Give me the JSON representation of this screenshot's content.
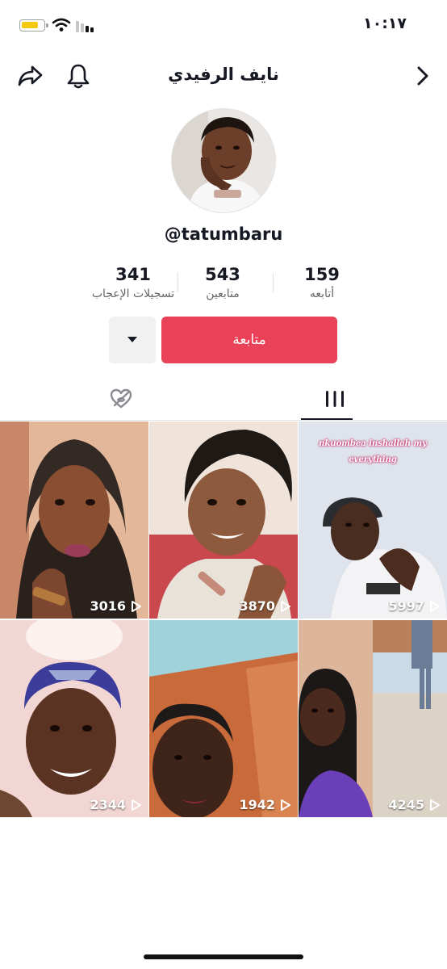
{
  "status_bar": {
    "time": "١٠:١٧"
  },
  "header": {
    "name": "نايف الرفيدي"
  },
  "profile": {
    "username": "@tatumbaru"
  },
  "stats": {
    "following": {
      "value": "159",
      "label": "أتابعه"
    },
    "followers": {
      "value": "543",
      "label": "متابعين"
    },
    "likes": {
      "value": "341",
      "label": "تسجيلات الإعجاب"
    }
  },
  "actions": {
    "follow_label": "متابعة"
  },
  "videos": [
    {
      "views": "3016"
    },
    {
      "views": "3870"
    },
    {
      "views": "5997",
      "caption_line1": "nkuombea inshallah my",
      "caption_line2": "everything"
    },
    {
      "views": "2344"
    },
    {
      "views": "1942"
    },
    {
      "views": "4245"
    }
  ],
  "colors": {
    "accent": "#ea4359",
    "text": "#161823"
  }
}
